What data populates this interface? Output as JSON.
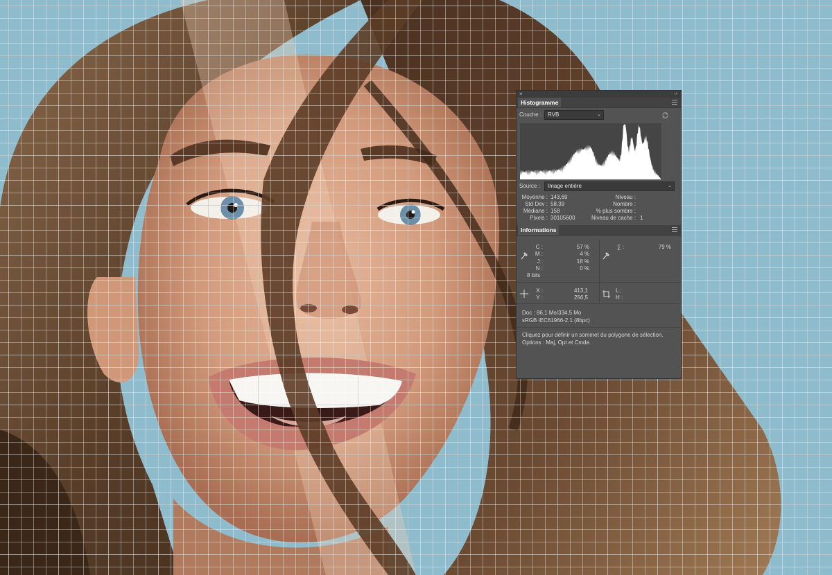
{
  "histogram_panel": {
    "close_glyph": "×",
    "collapse_glyph": "‹‹",
    "tab_label": "Histogramme",
    "channel_label": "Couche :",
    "channel_value": "RVB",
    "source_label": "Source :",
    "source_value": "Image entière",
    "stats": {
      "mean_label": "Moyenne :",
      "mean_value": "143,69",
      "stddev_label": "Std Dev :",
      "stddev_value": "58,39",
      "median_label": "Médiane :",
      "median_value": "158",
      "pixels_label": "Pixels :",
      "pixels_value": "30105600",
      "level_label": "Niveau :",
      "level_value": "",
      "count_label": "Nombre :",
      "count_value": "",
      "darker_label": "% plus sombre :",
      "darker_value": "",
      "cache_label": "Niveau de cache :",
      "cache_value": "1"
    }
  },
  "info_panel": {
    "tab_label": "Informations",
    "cmyk": {
      "c_label": "C :",
      "c_value": "57 %",
      "m_label": "M :",
      "m_value": "4 %",
      "j_label": "J :",
      "j_value": "18 %",
      "n_label": "N :",
      "n_value": "0 %",
      "bits": "8 bits"
    },
    "total_ink_label": "∑ :",
    "total_ink_value": "79 %",
    "coords": {
      "x_label": "X :",
      "x_value": "413,1",
      "y_label": "Y :",
      "y_value": "256,5"
    },
    "size": {
      "w_label": "L :",
      "w_value": "",
      "h_label": "H :",
      "h_value": ""
    },
    "doc_size": "Doc : 86,1 Mo/334,5 Mo",
    "profile": "sRGB IEC61966-2.1 (8bpc)",
    "hint_line1": "Cliquez pour définir un sommet du polygone de sélection.",
    "hint_line2": "Options : Maj, Opt et Cmde."
  },
  "colors": {
    "panel_bg": "#535353",
    "header_bg": "#3c3c3c",
    "histogram_fill": "#ffffff",
    "canvas_bg": "#8fbccd"
  }
}
